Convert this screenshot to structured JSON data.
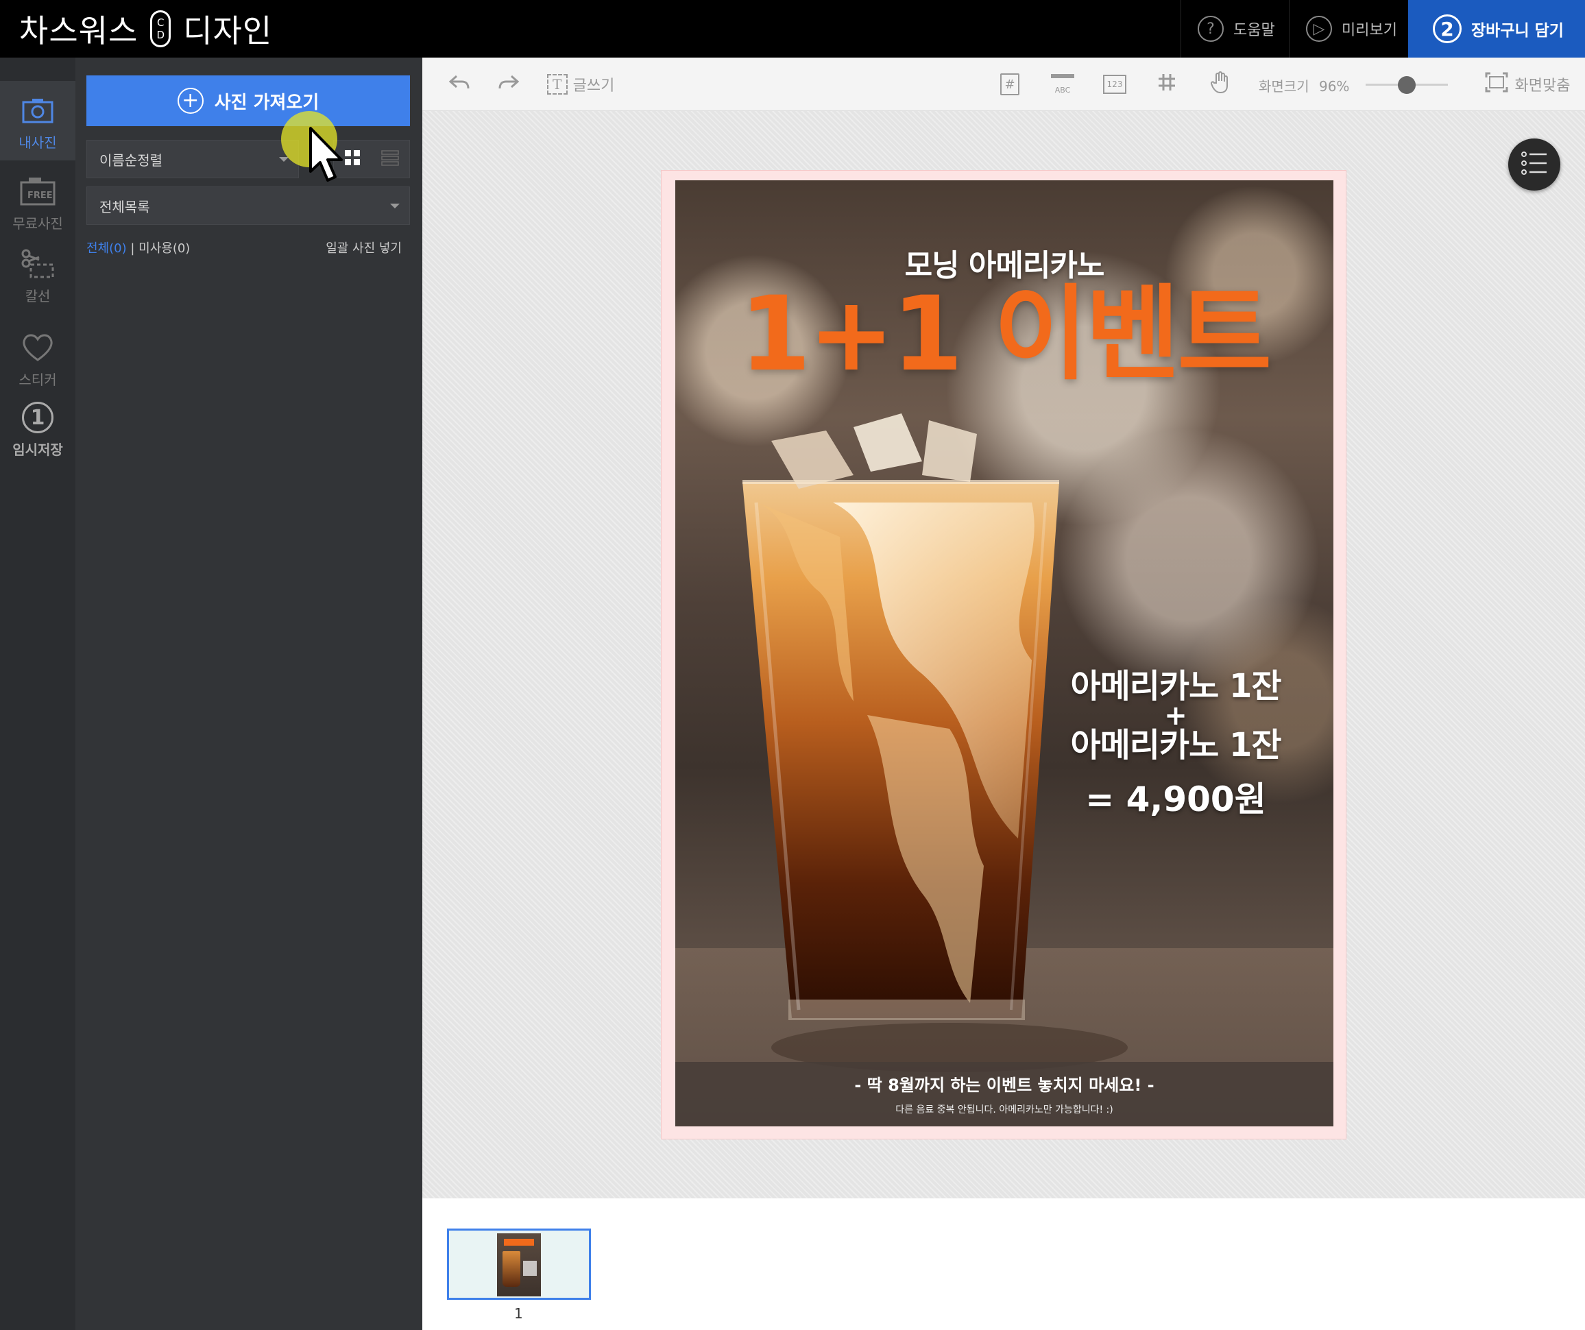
{
  "app": {
    "logo_left": "차스워스",
    "logo_mark_top": "C",
    "logo_mark_bottom": "D",
    "logo_right": "디자인"
  },
  "topbar": {
    "help": {
      "icon": "?",
      "label": "도움말"
    },
    "preview": {
      "icon": "▷",
      "label": "미리보기"
    },
    "cart": {
      "icon": "2",
      "label": "장바구니 담기"
    }
  },
  "rail": {
    "my_photos": "내사진",
    "free_photos": "무료사진",
    "free_badge": "FREE",
    "cutline": "칼선",
    "sticker": "스티커",
    "temp_save_icon": "1",
    "temp_save": "임시저장"
  },
  "panel": {
    "import_label": "사진 가져오기",
    "sort_value": "이름순정렬",
    "filter_value": "전체목록",
    "count_all": "전체(0)",
    "count_sep": " | ",
    "count_unused": "미사용(0)",
    "batch_insert": "일괄 사진 넣기"
  },
  "toolbar": {
    "write_text": "글쓰기",
    "write_icon": "T",
    "tool_hash": "#",
    "tool_abc": "ABC",
    "tool_123": "123",
    "zoom_label": "화면크기",
    "zoom_value": "96%",
    "zoom_level": 0.5,
    "fit_label": "화면맞춤"
  },
  "poster": {
    "subtitle": "모닝 아메리카노",
    "headline": "1+1 이벤트",
    "offer_line1": "아메리카노 1잔",
    "offer_plus": "+",
    "offer_line2": "아메리카노 1잔",
    "offer_price": "= 4,900원",
    "footer_main": "- 딱 8월까지 하는 이벤트 놓치지 마세요! -",
    "footer_sub": "다른 음료 중복 안됩니다. 아메리카노만 가능합니다! :)"
  },
  "filmstrip": {
    "page_number": "1"
  },
  "colors": {
    "accent": "#3f80ea",
    "cart": "#1b5bbf",
    "headline": "#f26a1b"
  }
}
